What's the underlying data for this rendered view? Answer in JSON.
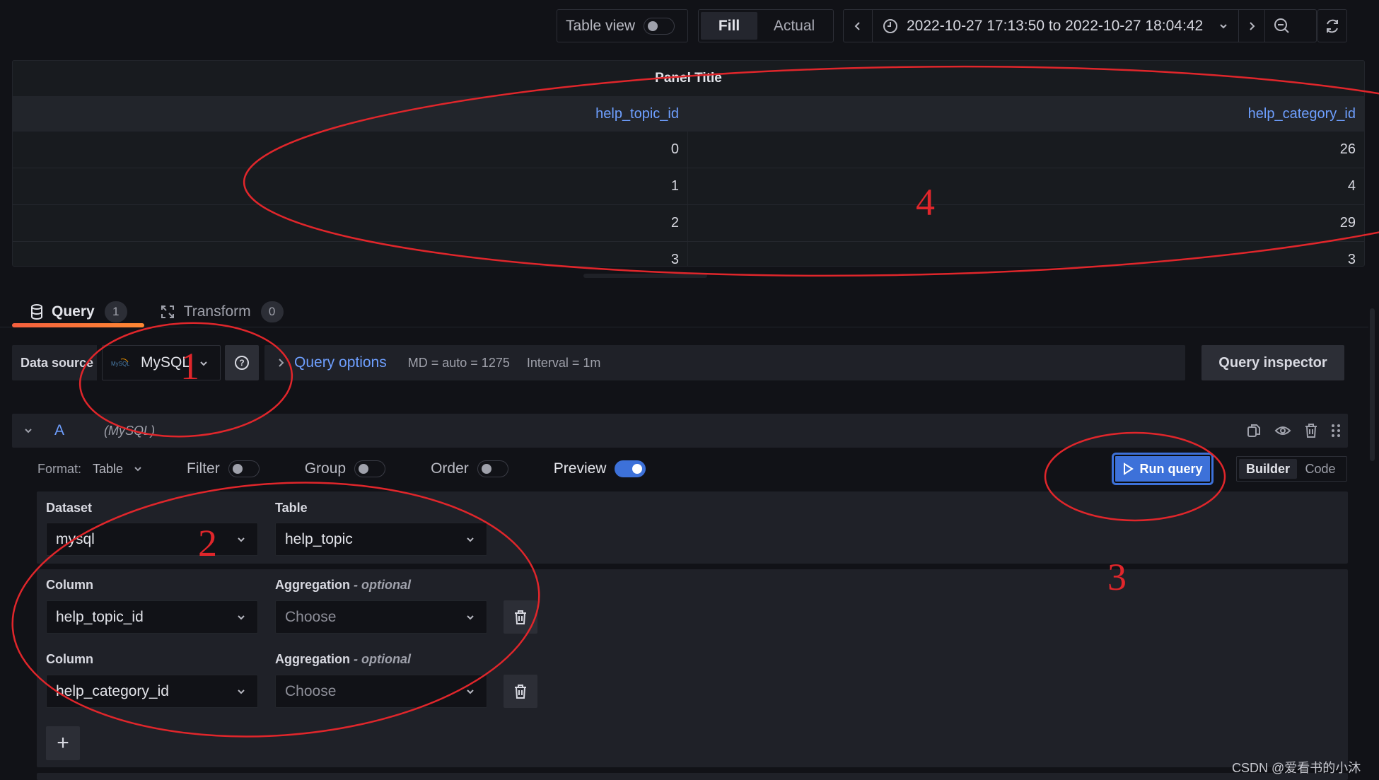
{
  "toolbar": {
    "table_view_label": "Table view",
    "table_view_on": false,
    "fill_label": "Fill",
    "actual_label": "Actual",
    "time_range": "2022-10-27 17:13:50 to 2022-10-27 18:04:42",
    "icons": {
      "prev": "chevron-left-icon",
      "clock": "clock-icon",
      "dropdown": "chevron-down-icon",
      "next": "chevron-right-icon",
      "zoom_out": "zoom-out-icon",
      "refresh": "refresh-icon"
    }
  },
  "panel": {
    "title": "Panel Title",
    "columns": [
      "help_topic_id",
      "help_category_id"
    ],
    "rows": [
      [
        "0",
        "26"
      ],
      [
        "1",
        "4"
      ],
      [
        "2",
        "29"
      ],
      [
        "3",
        "3"
      ]
    ]
  },
  "tabs": [
    {
      "label": "Query",
      "count": "1",
      "icon": "database-icon",
      "active": true
    },
    {
      "label": "Transform",
      "count": "0",
      "icon": "transform-icon",
      "active": false
    }
  ],
  "datasource": {
    "label": "Data source",
    "selected": "MySQL",
    "query_options_label": "Query options",
    "md": "MD = auto = 1275",
    "interval": "Interval = 1m",
    "query_inspector_label": "Query inspector"
  },
  "query": {
    "ref_id": "A",
    "ds_name": "(MySQL)",
    "format_label": "Format:",
    "format_value": "Table",
    "toggles": [
      {
        "label": "Filter",
        "on": false
      },
      {
        "label": "Group",
        "on": false
      },
      {
        "label": "Order",
        "on": false
      },
      {
        "label": "Preview",
        "on": true
      }
    ],
    "run_query_label": "Run query",
    "mode_builder": "Builder",
    "mode_code": "Code",
    "dataset_label": "Dataset",
    "dataset_value": "mysql",
    "table_label": "Table",
    "table_value": "help_topic",
    "columns": [
      {
        "column_label": "Column",
        "column_value": "help_topic_id",
        "agg_label": "Aggregation",
        "agg_optional": "- optional",
        "agg_placeholder": "Choose"
      },
      {
        "column_label": "Column",
        "column_value": "help_category_id",
        "agg_label": "Aggregation",
        "agg_optional": "- optional",
        "agg_placeholder": "Choose"
      }
    ],
    "add_label": "+"
  },
  "annotations": [
    "1",
    "2",
    "3",
    "4"
  ],
  "annotation_color": "#e0262b",
  "accent_color": "#3d71d9",
  "link_color": "#6e9fff",
  "tab_accent": "#ff8833",
  "watermark": "CSDN @爱看书的小沐"
}
